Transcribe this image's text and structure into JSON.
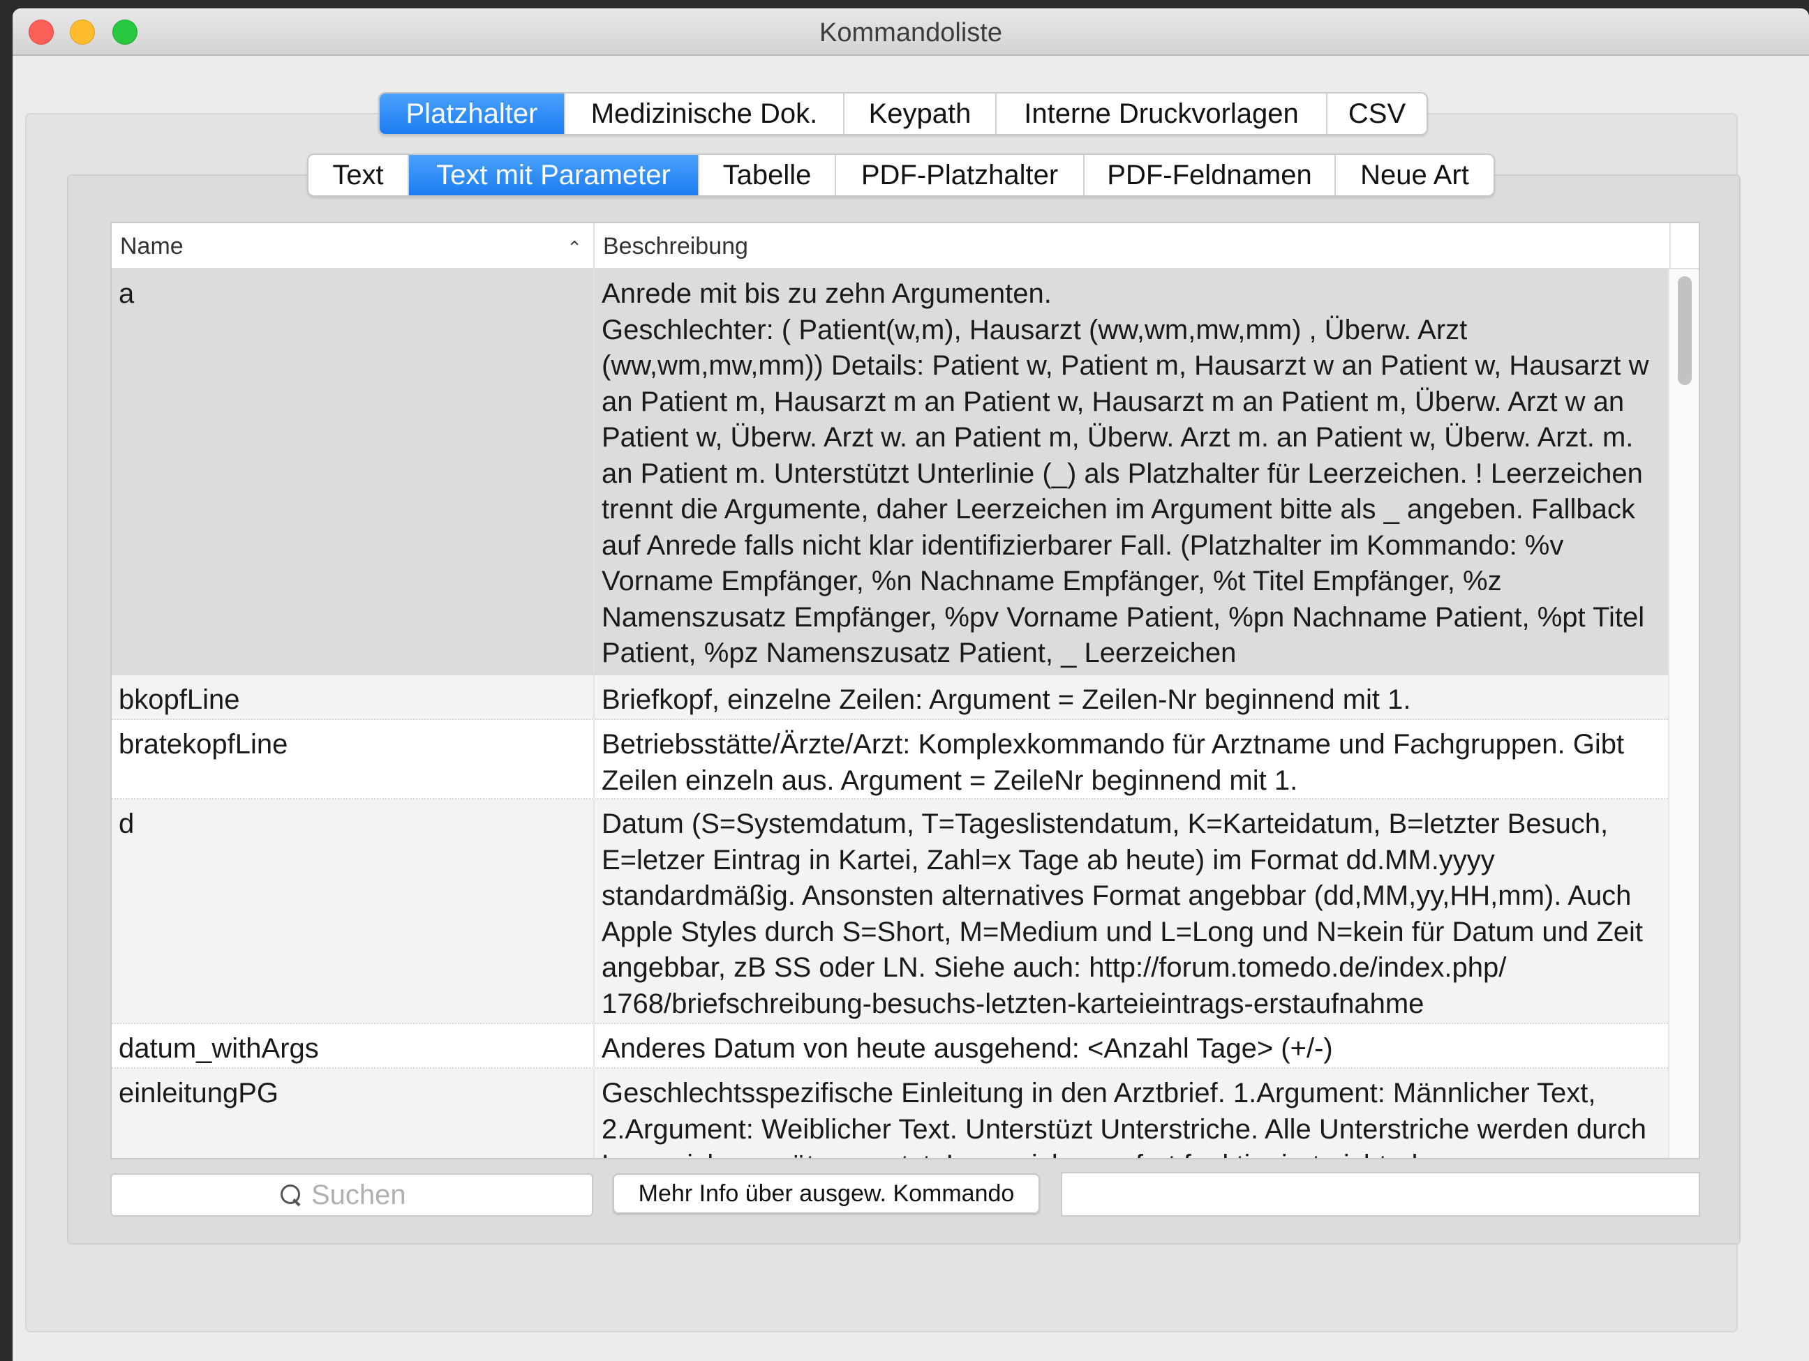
{
  "window": {
    "title": "Kommandoliste"
  },
  "main_tabs": [
    {
      "label": "Platzhalter",
      "active": true
    },
    {
      "label": "Medizinische Dok.",
      "active": false
    },
    {
      "label": "Keypath",
      "active": false
    },
    {
      "label": "Interne Druckvorlagen",
      "active": false
    },
    {
      "label": "CSV",
      "active": false
    }
  ],
  "sub_tabs": [
    {
      "label": "Text",
      "active": false
    },
    {
      "label": "Text mit Parameter",
      "active": true
    },
    {
      "label": "Tabelle",
      "active": false
    },
    {
      "label": "PDF-Platzhalter",
      "active": false
    },
    {
      "label": "PDF-Feldnamen",
      "active": false
    },
    {
      "label": "Neue Art",
      "active": false
    }
  ],
  "table": {
    "columns": {
      "name": "Name",
      "description": "Beschreibung"
    },
    "sort_icon": "chevron-up-icon",
    "rows": [
      {
        "name": "a",
        "description": "Anrede mit bis zu zehn Argumenten.\n Geschlechter: ( Patient(w,m), Hausarzt (ww,wm,mw,mm) , Überw. Arzt (ww,wm,mw,mm)) Details: Patient w, Patient m, Hausarzt w an Patient w, Hausarzt w an Patient m, Hausarzt m an Patient w, Hausarzt m an Patient m, Überw. Arzt w an Patient w, Überw. Arzt w. an Patient m, Überw. Arzt m. an Patient w, Überw. Arzt. m. an Patient m. Unterstützt Unterlinie (_) als Platzhalter für Leerzeichen. ! Leerzeichen trennt die Argumente, daher Leerzeichen im Argument bitte als _ angeben. Fallback auf Anrede falls nicht klar identifizierbarer Fall. (Platzhalter im Kommando: %v Vorname Empfänger, %n Nachname Empfänger, %t Titel Empfänger, %z Namenszusatz Empfänger, %pv Vorname Patient, %pn Nachname Patient, %pt Titel Patient, %pz Namenszusatz Patient, _ Leerzeichen",
        "selected": true
      },
      {
        "name": "bkopfLine",
        "description": "Briefkopf, einzelne Zeilen: Argument = Zeilen-Nr beginnend mit 1.",
        "selected": false
      },
      {
        "name": "bratekopfLine",
        "description": "Betriebsstätte/Ärzte/Arzt: Komplexkommando für Arztname und Fachgruppen. Gibt Zeilen einzeln aus. Argument = ZeileNr beginnend mit 1.",
        "selected": false
      },
      {
        "name": "d",
        "description": "Datum (S=Systemdatum, T=Tageslistendatum, K=Karteidatum, B=letzter Besuch, E=letzer Eintrag in Kartei, Zahl=x Tage ab heute) im Format dd.MM.yyyy standardmäßig. Ansonsten alternatives Format angebbar (dd,MM,yy,HH,mm). Auch Apple Styles durch S=Short, M=Medium und L=Long und N=kein für Datum und Zeit angebbar, zB SS oder LN. Siehe auch: http://forum.tomedo.de/index.php/\n1768/briefschreibung-besuchs-letzten-karteieintrags-erstaufnahme",
        "selected": false
      },
      {
        "name": "datum_withArgs",
        "description": "Anderes Datum von heute ausgehend: <Anzahl Tage> (+/-)",
        "selected": false
      },
      {
        "name": "einleitungPG",
        "description": "Geschlechtsspezifische Einleitung in den Arztbrief. 1.Argument: Männlicher Text, 2.Argument: Weiblicher Text. Unterstüzt Unterstriche. Alle Unterstriche werden durch Leerzeichen später ersetzt. Leerzeichen sofort funktioniert nicht, da",
        "selected": false
      }
    ]
  },
  "search": {
    "placeholder": "Suchen",
    "value": ""
  },
  "buttons": {
    "more_info": "Mehr Info über ausgew. Kommando"
  },
  "info_field": {
    "value": ""
  },
  "colors": {
    "accent": "#1c7cf2",
    "selected_row": "#dcdcdc",
    "window_bg": "#ececec"
  }
}
